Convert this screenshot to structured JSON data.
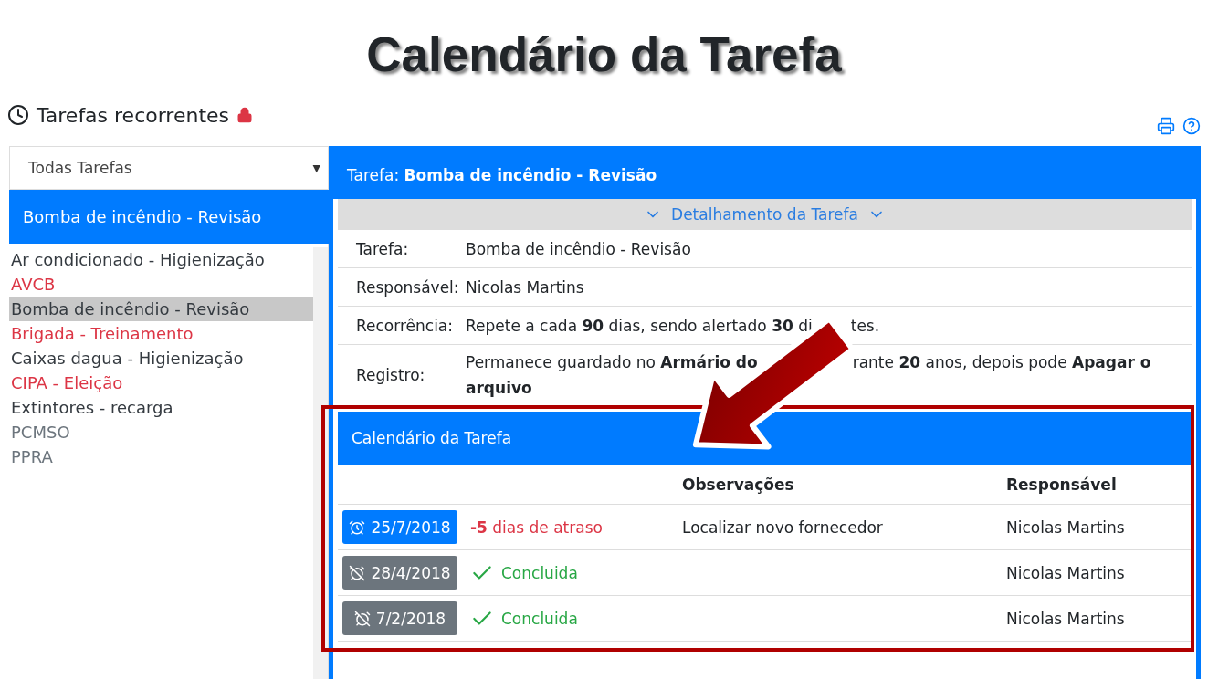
{
  "slide_title": "Calendário da Tarefa",
  "page": {
    "title": "Tarefas recorrentes",
    "locked": true
  },
  "filter": {
    "value": "Todas Tarefas",
    "caret": "▼"
  },
  "current_task": "Bomba de incêndio - Revisão",
  "task_list": [
    {
      "label": "Ar condicionado - Higienização",
      "color": "#343a40",
      "selected": false
    },
    {
      "label": "AVCB",
      "color": "#dc3545",
      "selected": false
    },
    {
      "label": "Bomba de incêndio - Revisão",
      "color": "#343a40",
      "selected": true
    },
    {
      "label": "Brigada - Treinamento",
      "color": "#dc3545",
      "selected": false
    },
    {
      "label": "Caixas dagua - Higienização",
      "color": "#343a40",
      "selected": false
    },
    {
      "label": "CIPA - Eleição",
      "color": "#dc3545",
      "selected": false
    },
    {
      "label": "Extintores - recarga",
      "color": "#343a40",
      "selected": false
    },
    {
      "label": "PCMSO",
      "color": "#6c757d",
      "selected": false
    },
    {
      "label": "PPRA",
      "color": "#6c757d",
      "selected": false
    }
  ],
  "detail": {
    "header": "Tarefa: **Bomba de incêndio - Revisão**",
    "toggle": "Detalhamento da Tarefa",
    "rows": [
      {
        "label": "Tarefa:",
        "lines": [
          [
            "Bomba de incêndio - Revisão"
          ]
        ]
      },
      {
        "label": "Responsável:",
        "lines": [
          [
            "Nicolas Martins"
          ]
        ]
      },
      {
        "label": "Recorrência:",
        "lines": [
          [
            "Repete a cada **90** dias, sendo alertado **30** di",
            "tes."
          ]
        ]
      },
      {
        "label": "Registro:",
        "lines": [
          [
            "Permanece guardado no **Armário do**",
            "rante **20** anos, depois pode **Apagar o**"
          ],
          [
            "**arquivo**"
          ]
        ]
      }
    ]
  },
  "calendar": {
    "title": "Calendário da Tarefa",
    "columns": [
      "Observações",
      "Responsável"
    ],
    "rows": [
      {
        "kind": "overdue",
        "date": "25/7/2018",
        "status": "**-5** dias de atraso",
        "note": "Localizar novo fornecedor",
        "owner": "Nicolas Martins"
      },
      {
        "kind": "done",
        "date": "28/4/2018",
        "status": "Concluida",
        "owner": "Nicolas Martins"
      },
      {
        "kind": "done",
        "date": "7/2/2018",
        "status": "Concluida",
        "owner": "Nicolas Martins"
      }
    ]
  }
}
